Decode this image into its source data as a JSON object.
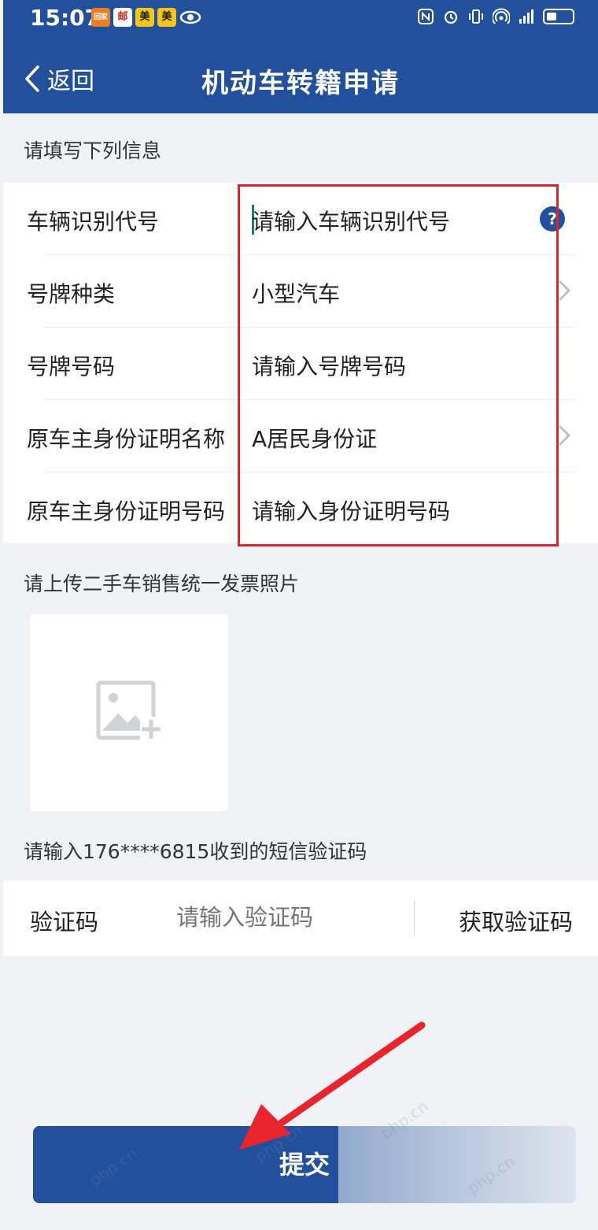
{
  "status_bar": {
    "time": "15:07",
    "notification_badges": [
      "回家",
      "邮",
      "美",
      "美"
    ]
  },
  "header": {
    "back_label": "返回",
    "title": "机动车转籍申请"
  },
  "form": {
    "section_title": "请填写下列信息",
    "rows": [
      {
        "label": "车辆识别代号",
        "placeholder": "请输入车辆识别代号",
        "has_help": true
      },
      {
        "label": "号牌种类",
        "value": "小型汽车",
        "has_chevron": true
      },
      {
        "label": "号牌号码",
        "placeholder": "请输入号牌号码"
      },
      {
        "label": "原车主身份证明名称",
        "value": "A居民身份证",
        "has_chevron": true
      },
      {
        "label": "原车主身份证明号码",
        "placeholder": "请输入身份证明号码"
      }
    ],
    "help_glyph": "?"
  },
  "upload": {
    "section_title": "请上传二手车销售统一发票照片",
    "icon": "image-add-icon"
  },
  "sms": {
    "prompt": "请输入176****6815收到的短信验证码",
    "label": "验证码",
    "placeholder": "请输入验证码",
    "get_code_label": "获取验证码"
  },
  "submit_label": "提交",
  "watermark": "php.cn",
  "colors": {
    "brand": "#22509c",
    "highlight": "#d9262e",
    "annotation_arrow": "#e8242c"
  }
}
